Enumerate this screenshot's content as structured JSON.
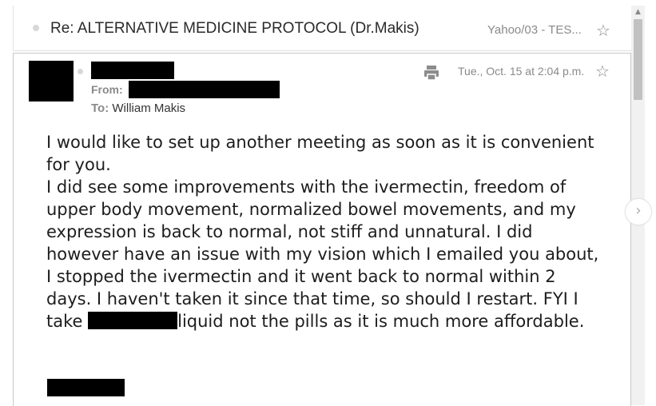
{
  "collapsed_message": {
    "subject": "Re: ALTERNATIVE MEDICINE PROTOCOL (Dr.Makis)",
    "folder": "Yahoo/03 - TES..."
  },
  "message": {
    "from_label": "From:",
    "to_label": "To:",
    "to_value": "William Makis",
    "date": "Tue., Oct. 15 at 2:04 p.m.",
    "body": {
      "para1": "I would like to set up another meeting as soon as it is convenient for you.",
      "para2_before": "I did see some improvements with the ivermectin, freedom of upper body movement, normalized bowel movements, and my expression is back to normal, not stiff and unnatural. I did however have an issue with my vision which I emailed you about, I stopped the ivermectin and it went back to normal within 2 days. I haven't taken it since that time, so should I restart. FYI I take ",
      "para2_after": "liquid not the pills as it is much more affordable."
    }
  },
  "icons": {
    "star": "star-outline-icon",
    "print": "print-icon",
    "next": "chevron-right-icon",
    "scroll_up": "scroll-up-arrow"
  },
  "colors": {
    "text": "#1d1d1d",
    "muted": "#8a8a8a",
    "redaction": "#000000"
  }
}
